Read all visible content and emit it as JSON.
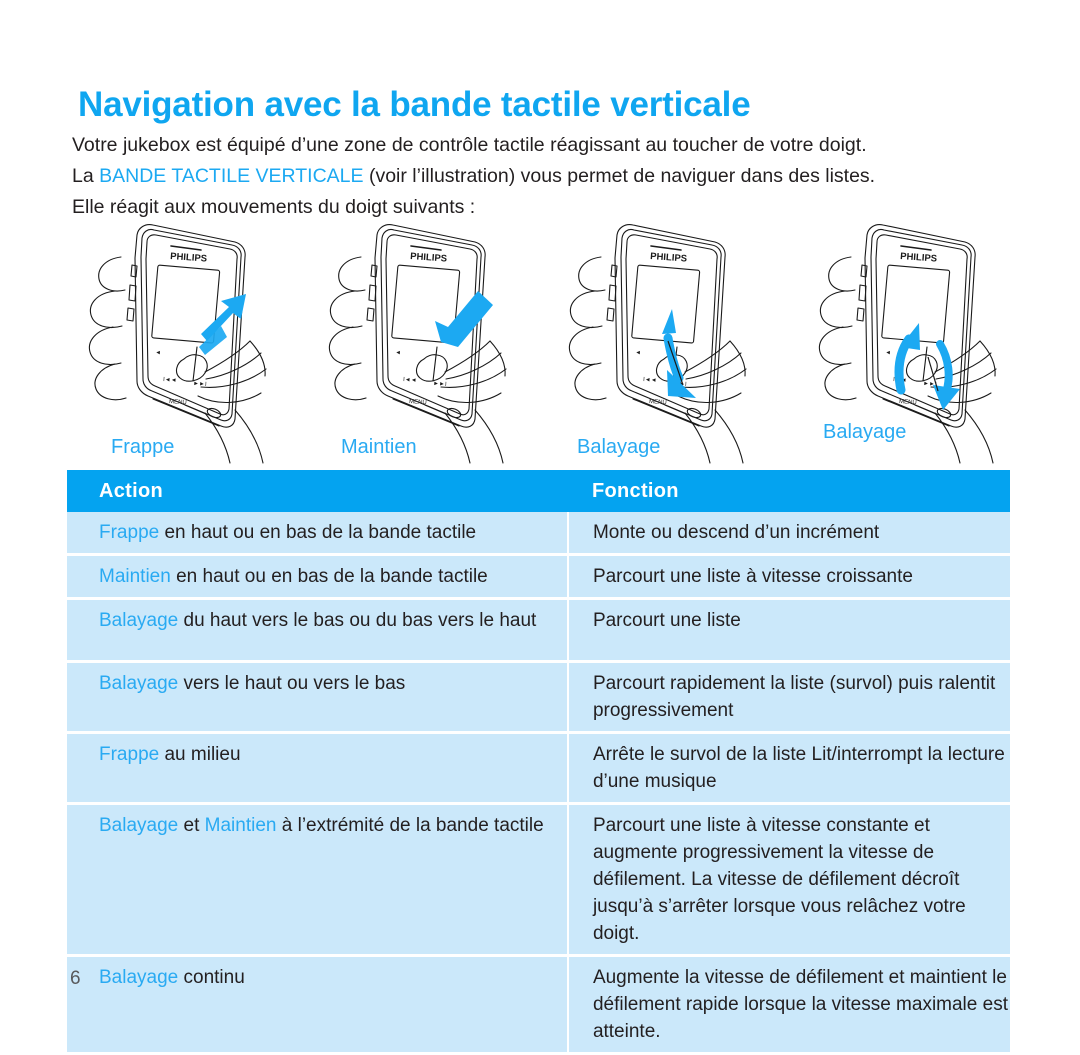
{
  "page_title": "Navigation avec la bande tactile verticale",
  "intro": {
    "line1": "Votre jukebox est équipé d’une zone de contrôle tactile réagissant au toucher de votre doigt.",
    "line2_prefix": "La ",
    "line2_highlight": "BANDE TACTILE VERTICALE",
    "line2_suffix": " (voir l’illustration) vous permet de naviguer dans des listes.",
    "line3": "Elle réagit aux mouvements du doigt suivants :"
  },
  "illustrations": [
    {
      "label": "Frappe",
      "device_brand": "PHILIPS",
      "gesture": "tap-up-arrow"
    },
    {
      "label": "Maintien",
      "device_brand": "PHILIPS",
      "gesture": "hold-down-arrow"
    },
    {
      "label": "Balayage",
      "device_brand": "PHILIPS",
      "gesture": "swipe-down-curved-arrow"
    },
    {
      "label": "Balayage",
      "device_brand": "PHILIPS",
      "gesture": "swipe-up-and-down-curved-arrows"
    }
  ],
  "device_buttons": [
    "◄",
    "I◄◄",
    "►►I",
    "MENU"
  ],
  "table": {
    "headers": {
      "action": "Action",
      "fonction": "Fonction"
    },
    "rows": [
      {
        "action_highlight": "Frappe",
        "action_rest": " en haut ou en bas de la bande tactile",
        "fonction": "Monte ou descend d’un incrément"
      },
      {
        "action_highlight": "Maintien",
        "action_rest": " en haut ou en bas de la bande tactile",
        "fonction": "Parcourt une liste à vitesse croissante"
      },
      {
        "action_highlight": "Balayage",
        "action_rest": " du haut vers le bas ou du bas vers le haut",
        "fonction": "Parcourt une liste"
      },
      {
        "action_highlight": "Balayage",
        "action_rest": " vers le haut ou vers le bas",
        "fonction": "Parcourt rapidement la liste (survol) puis ralentit progressivement"
      },
      {
        "action_highlight": "Frappe",
        "action_rest": " au milieu",
        "fonction": "Arrête le survol de la liste Lit/interrompt la lecture d’une musique"
      },
      {
        "action_highlight": "Balayage",
        "action_mid": " et ",
        "action_highlight2": "Maintien",
        "action_rest": " à l’extrémité de la bande tactile",
        "fonction": "Parcourt une liste à vitesse constante et augmente progressivement la vitesse de défilement. La vitesse de défilement décroît jusqu’à s’arrêter lorsque vous relâchez votre doigt."
      },
      {
        "action_highlight": "Balayage",
        "action_rest": " continu",
        "fonction": "Augmente la vitesse de défilement et maintient le défilement rapide lorsque la vitesse maximale est atteinte."
      }
    ]
  },
  "page_number": "6",
  "colors": {
    "brand_blue": "#0FA6F0",
    "header_blue": "#04A3F0",
    "row_blue": "#CBE8FA",
    "accent_text": "#29AAF2",
    "body_text": "#231f20"
  }
}
